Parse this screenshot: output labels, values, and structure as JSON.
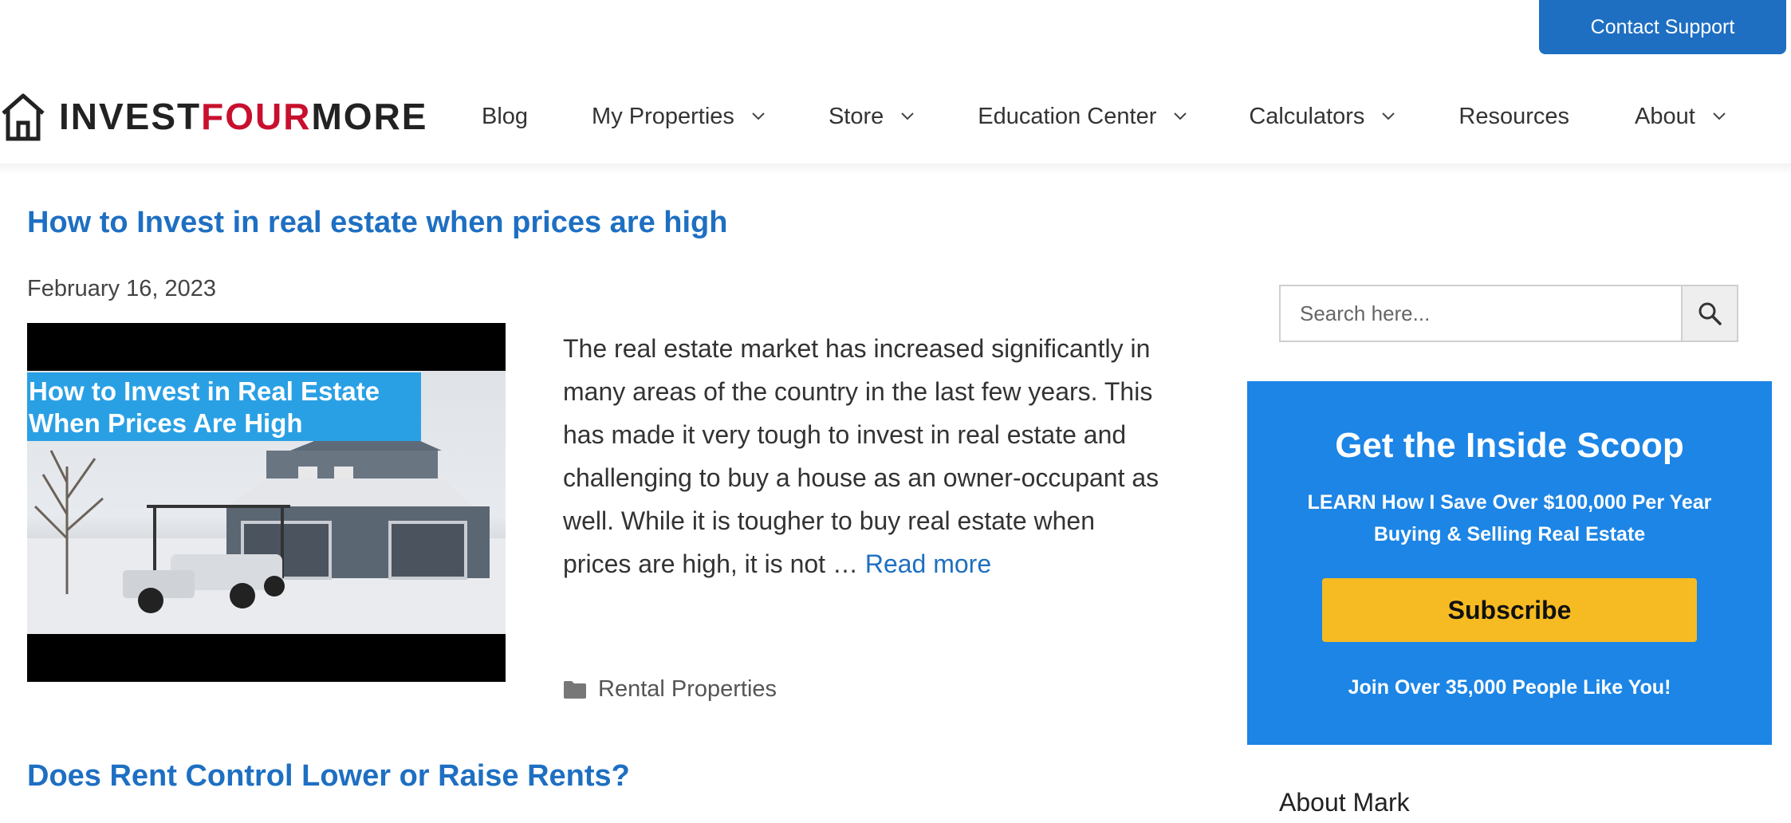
{
  "topbar": {
    "contact_label": "Contact Support"
  },
  "logo": {
    "part1": "INVEST",
    "part2": "FOUR",
    "part3": "MORE"
  },
  "nav": {
    "items": [
      {
        "label": "Blog"
      },
      {
        "label": "My Properties"
      },
      {
        "label": "Store"
      },
      {
        "label": "Education Center"
      },
      {
        "label": "Calculators"
      },
      {
        "label": "Resources"
      },
      {
        "label": "About"
      }
    ]
  },
  "posts": [
    {
      "title": "How to Invest in real estate when prices are high",
      "date": "February 16, 2023",
      "thumb_caption_line1": "How to Invest in Real Estate",
      "thumb_caption_line2": "When Prices Are High",
      "excerpt": "The real estate market has increased significantly in many areas of the country in the last few years. This has made it very tough to invest in real estate and challenging to buy a house as an owner-occupant as well. While it is tougher to buy real estate when prices are high, it is not … ",
      "read_more": "Read more",
      "category": "Rental Properties"
    },
    {
      "title": "Does Rent Control Lower or Raise Rents?"
    }
  ],
  "sidebar": {
    "search_placeholder": "Search here...",
    "scoop": {
      "title": "Get the Inside Scoop",
      "sub_line1": "LEARN How I Save Over $100,000 Per Year",
      "sub_line2": "Buying & Selling Real Estate",
      "button": "Subscribe",
      "footer": "Join Over 35,000 People Like You!"
    },
    "about_heading": "About Mark"
  },
  "colors": {
    "link_blue": "#1e6fc2",
    "logo_red": "#c8102e",
    "scoop_blue": "#1c85e6",
    "subscribe_yellow": "#f6bb22"
  }
}
